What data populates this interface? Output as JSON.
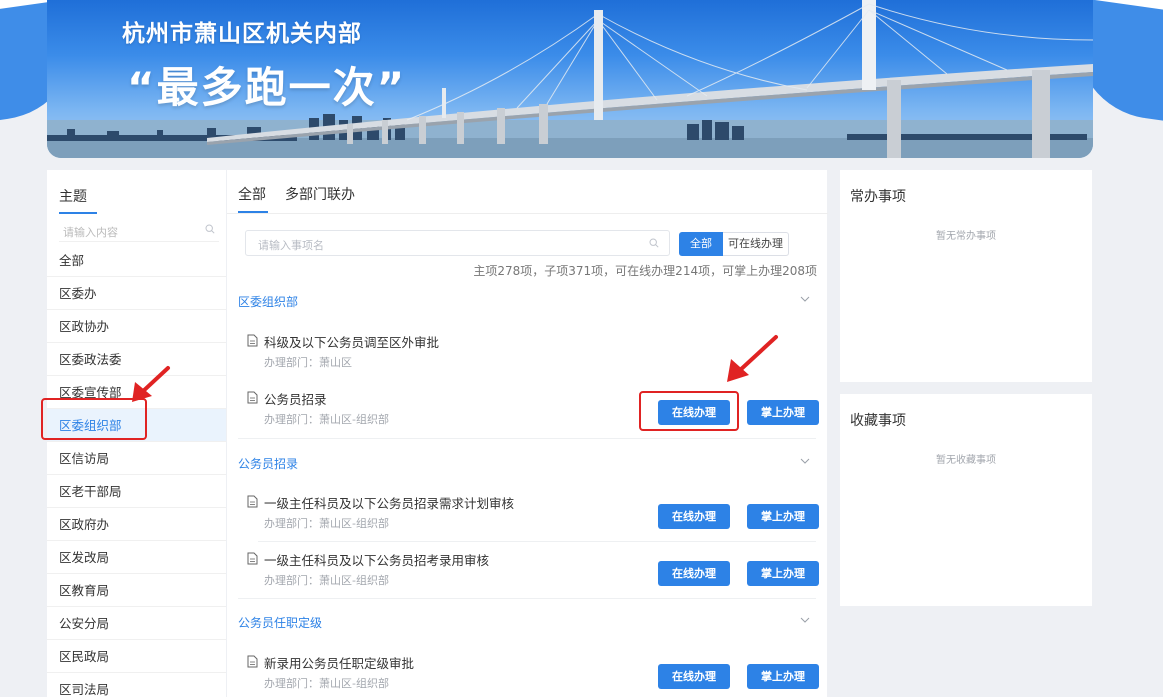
{
  "banner": {
    "title": "杭州市萧山区机关内部",
    "slogan": "“最多跑一次”"
  },
  "sidebar": {
    "title": "主题",
    "search_placeholder": "请输入内容",
    "items": [
      {
        "label": "全部"
      },
      {
        "label": "区委办"
      },
      {
        "label": "区政协办"
      },
      {
        "label": "区委政法委"
      },
      {
        "label": "区委宣传部"
      },
      {
        "label": "区委组织部",
        "active": true
      },
      {
        "label": "区信访局"
      },
      {
        "label": "区老干部局"
      },
      {
        "label": "区政府办"
      },
      {
        "label": "区发改局"
      },
      {
        "label": "区教育局"
      },
      {
        "label": "公安分局"
      },
      {
        "label": "区民政局"
      },
      {
        "label": "区司法局"
      }
    ]
  },
  "main": {
    "tabs": [
      {
        "label": "全部",
        "active": true
      },
      {
        "label": "多部门联办"
      }
    ],
    "search_placeholder": "请输入事项名",
    "filters": {
      "all": "全部",
      "online": "可在线办理"
    },
    "stats": "主项278项，子项371项，可在线办理214项，可掌上办理208项",
    "groups": [
      {
        "title": "区委组织部",
        "items": [
          {
            "name": "科级及以下公务员调至区外审批",
            "dept": "办理部门：萧山区",
            "buttons": false
          },
          {
            "name": "公务员招录",
            "dept": "办理部门：萧山区-组织部",
            "buttons": true
          }
        ]
      },
      {
        "title": "公务员招录",
        "items": [
          {
            "name": "一级主任科员及以下公务员招录需求计划审核",
            "dept": "办理部门：萧山区-组织部",
            "buttons": true
          },
          {
            "name": "一级主任科员及以下公务员招考录用审核",
            "dept": "办理部门：萧山区-组织部",
            "buttons": true
          }
        ]
      },
      {
        "title": "公务员任职定级",
        "items": [
          {
            "name": "新录用公务员任职定级审批",
            "dept": "办理部门：萧山区-组织部",
            "buttons": true
          }
        ]
      }
    ],
    "button_online": "在线办理",
    "button_mobile": "掌上办理"
  },
  "right": {
    "frequent": {
      "title": "常办事项",
      "empty": "暂无常办事项"
    },
    "favorites": {
      "title": "收藏事项",
      "empty": "暂无收藏事项"
    }
  },
  "colors": {
    "accent": "#2d82e6",
    "annotation": "#e02323"
  }
}
